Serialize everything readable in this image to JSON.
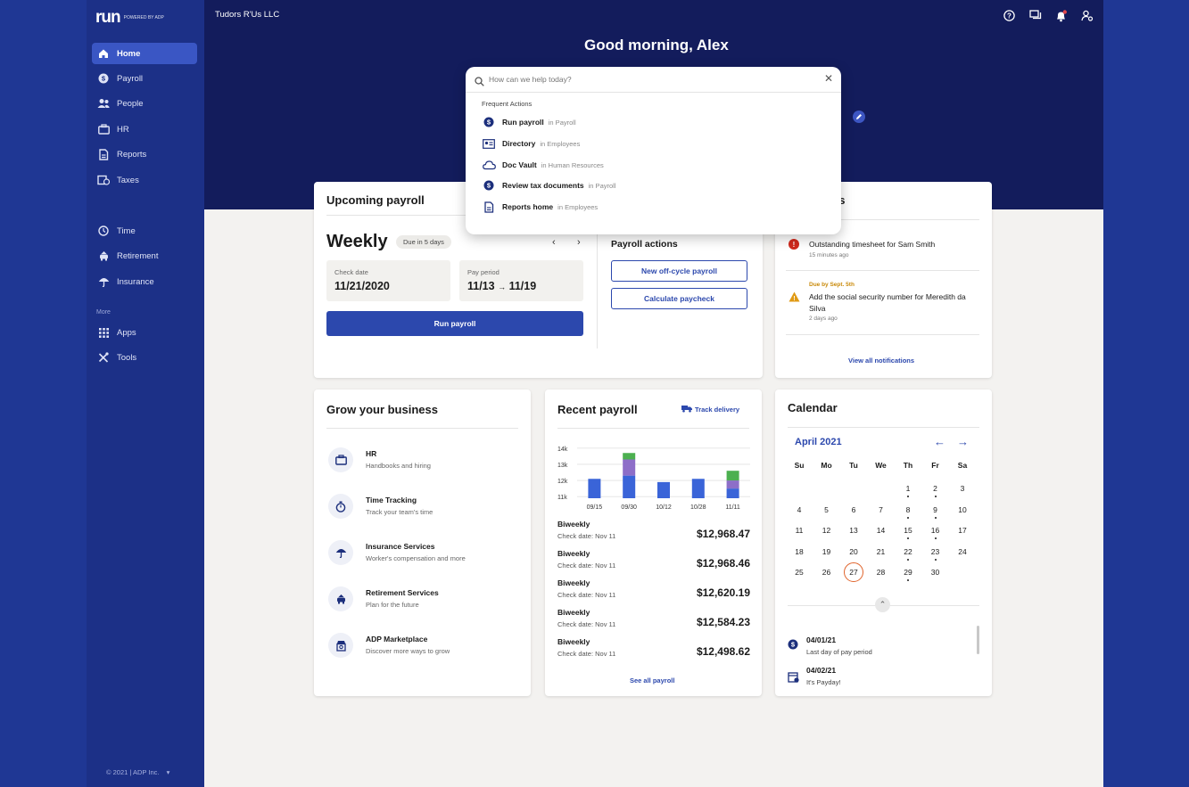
{
  "company_name": "Tudors R'Us LLC",
  "greeting": "Good morning, Alex",
  "logo": {
    "text": "run",
    "tagline": "POWERED BY ADP"
  },
  "nav": {
    "items": [
      {
        "label": "Home",
        "icon": "home-icon"
      },
      {
        "label": "Payroll",
        "icon": "dollar-icon"
      },
      {
        "label": "People",
        "icon": "people-icon"
      },
      {
        "label": "HR",
        "icon": "briefcase-icon"
      },
      {
        "label": "Reports",
        "icon": "reports-icon"
      },
      {
        "label": "Taxes",
        "icon": "taxes-icon"
      },
      {
        "label": "Time",
        "icon": "clock-icon"
      },
      {
        "label": "Retirement",
        "icon": "piggy-bank-icon"
      },
      {
        "label": "Insurance",
        "icon": "umbrella-icon"
      },
      {
        "label": "Apps",
        "icon": "grid-icon"
      },
      {
        "label": "Tools",
        "icon": "tools-icon"
      }
    ],
    "more_label": "More",
    "copyright": "© 2021 | ADP Inc."
  },
  "search": {
    "placeholder": "How can we help today?",
    "frequent_label": "Frequent Actions",
    "actions": [
      {
        "name": "Run payroll",
        "context": "in Payroll"
      },
      {
        "name": "Directory",
        "context": "in Employees"
      },
      {
        "name": "Doc Vault",
        "context": "in Human Resources"
      },
      {
        "name": "Review tax documents",
        "context": "in Payroll"
      },
      {
        "name": "Reports home",
        "context": "in Employees"
      }
    ]
  },
  "upcoming": {
    "title": "Upcoming payroll",
    "frequency": "Weekly",
    "due_badge": "Due in 5 days",
    "check_date_label": "Check date",
    "check_date": "11/21/2020",
    "pay_period_label": "Pay period",
    "pay_period_start": "11/13",
    "pay_period_end": "11/19",
    "run_button": "Run payroll",
    "actions_title": "Payroll actions",
    "action1": "New off-cycle payroll",
    "action2": "Calculate paycheck"
  },
  "notifications": {
    "title_suffix": "es",
    "items": [
      {
        "status": "Overdue",
        "text": "Outstanding timesheet for Sam Smith",
        "time": "15 minutes ago"
      },
      {
        "status": "Due by Sept. 5th",
        "text": "Add the social security number for Meredith da Silva",
        "time": "2 days ago"
      }
    ],
    "view_all": "View all notifications",
    "colors": {
      "overdue": "#d0291c",
      "due": "#c98a0a"
    }
  },
  "grow": {
    "title": "Grow your business",
    "items": [
      {
        "title": "HR",
        "subtitle": "Handbooks and hiring",
        "icon": "briefcase-icon"
      },
      {
        "title": "Time Tracking",
        "subtitle": "Track your team's time",
        "icon": "stopwatch-icon"
      },
      {
        "title": "Insurance Services",
        "subtitle": "Worker's compensation and more",
        "icon": "umbrella-icon"
      },
      {
        "title": "Retirement Services",
        "subtitle": "Plan for the future",
        "icon": "piggy-bank-icon"
      },
      {
        "title": "ADP Marketplace",
        "subtitle": "Discover more ways to grow",
        "icon": "marketplace-icon"
      }
    ]
  },
  "recent": {
    "title": "Recent payroll",
    "track": "Track delivery",
    "rows": [
      {
        "freq": "Biweekly",
        "date": "Check date: Nov 11",
        "amount": "$12,968.47"
      },
      {
        "freq": "Biweekly",
        "date": "Check date: Nov 11",
        "amount": "$12,968.46"
      },
      {
        "freq": "Biweekly",
        "date": "Check date: Nov 11",
        "amount": "$12,620.19"
      },
      {
        "freq": "Biweekly",
        "date": "Check date: Nov 11",
        "amount": "$12,584.23"
      },
      {
        "freq": "Biweekly",
        "date": "Check date: Nov 11",
        "amount": "$12,498.62"
      }
    ],
    "see_all": "See all payroll"
  },
  "chart_data": {
    "type": "bar",
    "categories": [
      "09/15",
      "09/30",
      "10/12",
      "10/28",
      "11/11"
    ],
    "series": [
      {
        "values": [
          12.1,
          12.3,
          11.9,
          12.1,
          11.5
        ],
        "color": "#3a64d8"
      },
      {
        "values": [
          0,
          1.0,
          0,
          0,
          0.5
        ],
        "color": "#8d6ec8"
      },
      {
        "values": [
          0,
          0.4,
          0,
          0,
          0.6
        ],
        "color": "#4cb050"
      }
    ],
    "yticks": [
      "14k",
      "13k",
      "12k",
      "11k"
    ],
    "ylim": [
      10.9,
      14.1
    ],
    "grid": true
  },
  "calendar": {
    "title": "Calendar",
    "month": "April 2021",
    "weekdays": [
      "Su",
      "Mo",
      "Tu",
      "We",
      "Th",
      "Fr",
      "Sa"
    ],
    "weeks": [
      [
        "",
        "",
        "",
        "",
        "1",
        "2",
        "3"
      ],
      [
        "4",
        "5",
        "6",
        "7",
        "8",
        "9",
        "10"
      ],
      [
        "11",
        "12",
        "13",
        "14",
        "15",
        "16",
        "17"
      ],
      [
        "18",
        "19",
        "20",
        "21",
        "22",
        "23",
        "24"
      ],
      [
        "25",
        "26",
        "27",
        "28",
        "29",
        "30",
        ""
      ]
    ],
    "dotted_days": [
      "1",
      "2",
      "8",
      "9",
      "15",
      "16",
      "22",
      "23",
      "29"
    ],
    "today": "27",
    "today_color": "#e0642c",
    "events": [
      {
        "date": "04/01/21",
        "text": "Last day of pay period",
        "icon": "dollar-icon"
      },
      {
        "date": "04/02/21",
        "text": "It's Payday!",
        "icon": "calendar-dollar-icon"
      }
    ]
  }
}
